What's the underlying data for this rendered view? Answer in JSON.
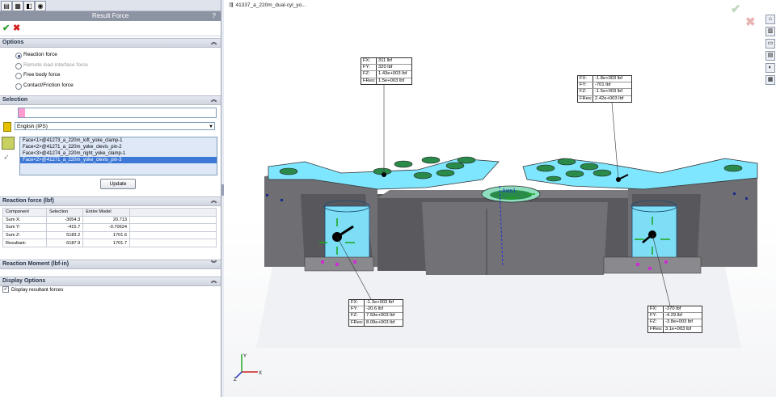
{
  "panel": {
    "title": "Result Force",
    "help": "?",
    "ok_icon": "✔",
    "cancel_icon": "✖",
    "tabs": [
      "feature-manager-icon",
      "property-manager-icon",
      "config-manager-icon",
      "simulation-icon"
    ],
    "options": {
      "header": "Options",
      "items": [
        {
          "label": "Reaction force",
          "selected": true,
          "enabled": true
        },
        {
          "label": "Remote load interface force",
          "selected": false,
          "enabled": false
        },
        {
          "label": "Free body force",
          "selected": false,
          "enabled": true
        },
        {
          "label": "Contact/Friction force",
          "selected": false,
          "enabled": true
        }
      ]
    },
    "selection": {
      "header": "Selection",
      "units": "English (IPS)",
      "faces": [
        "Face<1>@41273_a_220m_loft_yoke_clamp-1",
        "Face<2>@41271_a_220m_yoke_clevis_pin-2",
        "Face<3>@41274_a_220m_right_yoke_clamp-1",
        "Face<2>@41271_a_220m_yoke_clevis_pin-3"
      ],
      "selected_index": 3,
      "update_label": "Update"
    },
    "reaction_force": {
      "header": "Reaction force (lbf)",
      "columns": [
        "Component",
        "Selection",
        "Entire Model"
      ],
      "rows": [
        [
          "Sum X:",
          "-3054.3",
          "20.713"
        ],
        [
          "Sum Y:",
          "-415.7",
          "-0.70624"
        ],
        [
          "Sum Z:",
          "5183.2",
          "1701.6"
        ],
        [
          "Resultant:",
          "6187.9",
          "1701.7"
        ]
      ]
    },
    "reaction_moment": {
      "header": "Reaction Moment (lbf-in)"
    },
    "display_options": {
      "header": "Display Options",
      "checkbox_label": "Display resultant forces",
      "checked": true
    }
  },
  "viewport": {
    "doc_title": "41337_a_220m_dual-cyl_yo...",
    "axis_label": "Axis1",
    "callouts": [
      {
        "id": "top-left",
        "FX": "311 lbf",
        "FY": "320 lbf",
        "FZ": "1.43e+003 lbf",
        "FRes": "1.5e+003 lbf"
      },
      {
        "id": "top-right",
        "FX": "-1.8e+003 lbf",
        "FY": "-701 lbf",
        "FZ": "-1.5e+003 lbf",
        "FRes": "2.42e+003 lbf"
      },
      {
        "id": "bottom-left",
        "FX": "-1.3e+003 lbf",
        "FY": "-20.6 lbf",
        "FZ": "7.59e+003 lbf",
        "FRes": "8.09e+003 lbf"
      },
      {
        "id": "bottom-right",
        "FX": "-370 lbf",
        "FY": "-4.29 lbf",
        "FZ": "-3.8e+003 lbf",
        "FRes": "3.1e+003 lbf"
      }
    ],
    "callout_keys": [
      "FX:",
      "FY:",
      "FZ:",
      "FRes:"
    ],
    "triad": {
      "x": "X",
      "y": "Y",
      "z": "Z"
    }
  },
  "colors": {
    "accent": "#3d78d6",
    "face_highlight": "#7fe6ff",
    "model_grey": "#6f6f73",
    "model_dark": "#4a4a4e"
  }
}
